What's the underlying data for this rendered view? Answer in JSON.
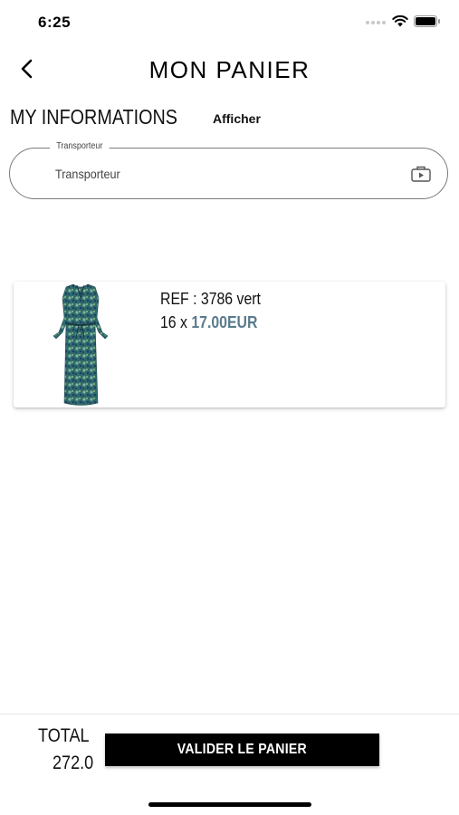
{
  "status_bar": {
    "time": "6:25",
    "icons": [
      "cellular-signal-icon",
      "wifi-icon",
      "battery-icon"
    ]
  },
  "header": {
    "back_icon": "chevron-left-icon",
    "title": "MON PANIER"
  },
  "informations": {
    "heading": "MY INFORMATIONS",
    "show_link": "Afficher"
  },
  "carrier_field": {
    "label": "Transporteur",
    "value": "Transporteur",
    "icon": "dropdown-selector-icon"
  },
  "cart_items": [
    {
      "ref_line": "REF : 3786 vert",
      "quantity_prefix": "16 x ",
      "price": "17.00EUR",
      "image": "floral-maxi-dress-image"
    }
  ],
  "footer": {
    "total_label": "TOTAL",
    "total_value": "272.0",
    "validate_label": "VALIDER LE PANIER"
  },
  "colors": {
    "price_accent": "#5a7b8c",
    "button_bg": "#000000",
    "button_text": "#ffffff",
    "field_border": "#7a7a7a"
  }
}
